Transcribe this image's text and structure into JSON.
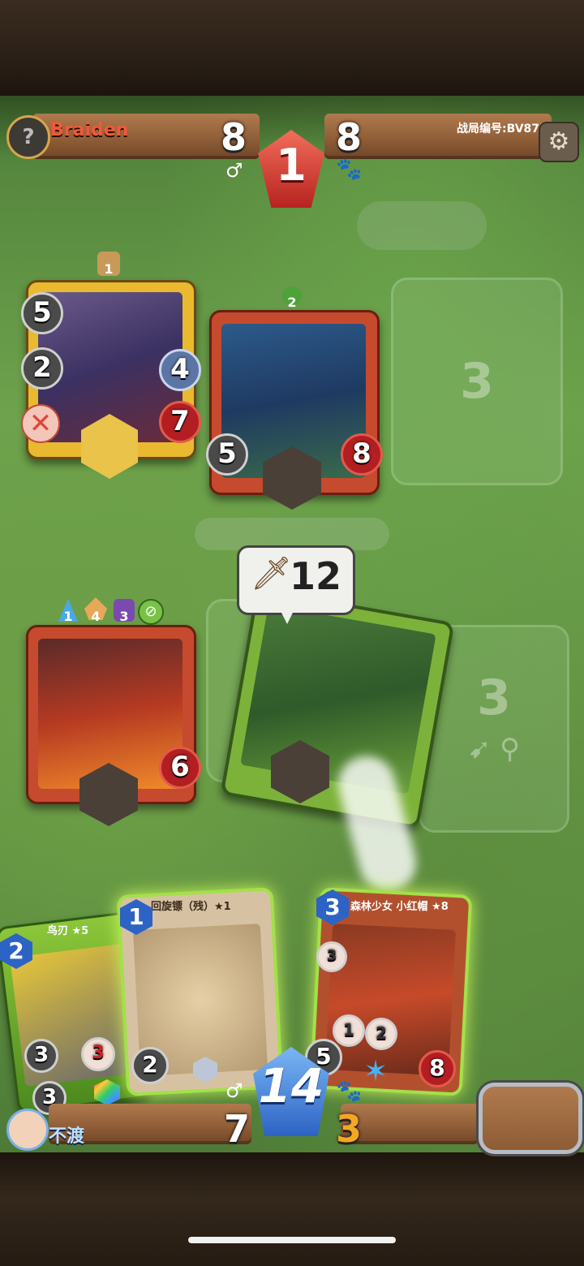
{
  "opponent": {
    "name": "Braiden",
    "avatar_icon": "question-mark-icon",
    "mana": "8",
    "beasts": "8",
    "match_id": "战局编号:BV87P",
    "turn": "1"
  },
  "player": {
    "name": "不渡",
    "mana": "14",
    "left_resource": "7",
    "beasts": "3"
  },
  "enemy_board": [
    {
      "level": "1",
      "attack": "5",
      "range": "2",
      "armor": "4",
      "health": "7",
      "status": "x-mark-icon"
    },
    {
      "level": "2",
      "attack": "5",
      "health": "8"
    }
  ],
  "enemy_slot": {
    "label": "3"
  },
  "player_board": [
    {
      "buffs": [
        "1",
        "4",
        "3"
      ],
      "health": "6"
    }
  ],
  "player_slot": {
    "label": "3"
  },
  "attack_bubble": {
    "value": "12"
  },
  "hand": [
    {
      "cost": "2",
      "title": "鸟刃 ★5",
      "stat_a": "3",
      "stat_b": "3",
      "stat_c": "3"
    },
    {
      "cost": "1",
      "title": "回旋镖（残）★1",
      "stat": "2"
    },
    {
      "cost": "3",
      "title": "森林少女 小红帽 ★8",
      "stat_a": "3",
      "stat_b": "1",
      "stat_c": "2",
      "attack": "5",
      "health": "8"
    }
  ],
  "colors": {
    "accent_red": "#f05a3a",
    "mana_blue": "#2c63c4",
    "beast_gold": "#f5a623"
  }
}
